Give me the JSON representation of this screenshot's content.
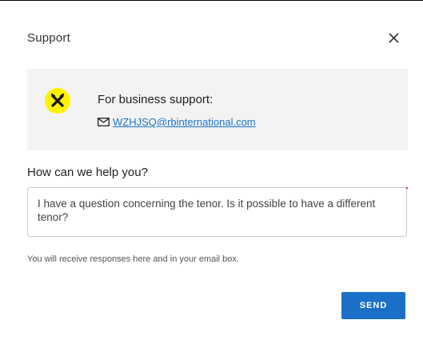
{
  "dialog": {
    "title": "Support",
    "close_icon": "close-icon"
  },
  "contact": {
    "logo_icon": "raiffeisen-crossed-gables-logo",
    "logo_color": "#fff200",
    "title": "For business support:",
    "mail_icon": "envelope-icon",
    "email": "WZHJSQ@rbinternational.com"
  },
  "form": {
    "question_label": "How can we help you?",
    "message_value": "I have a question concerning the tenor. Is it possible to have a different tenor?",
    "hint": "You will receive responses here and in your email box.",
    "send_label": "SEND"
  },
  "colors": {
    "accent": "#1a6fc7",
    "link": "#1a73c9",
    "panel_background": "#f3f3f3"
  }
}
